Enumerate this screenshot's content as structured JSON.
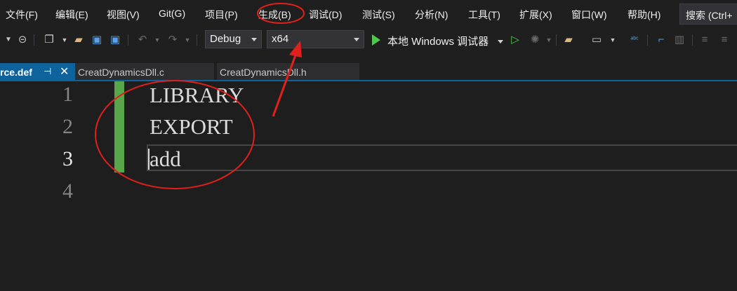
{
  "menu": {
    "items": [
      {
        "label": "文件(F)"
      },
      {
        "label": "编辑(E)"
      },
      {
        "label": "视图(V)"
      },
      {
        "label": "Git(G)"
      },
      {
        "label": "项目(P)"
      },
      {
        "label": "生成(B)"
      },
      {
        "label": "调试(D)"
      },
      {
        "label": "测试(S)"
      },
      {
        "label": "分析(N)"
      },
      {
        "label": "工具(T)"
      },
      {
        "label": "扩展(X)"
      },
      {
        "label": "窗口(W)"
      },
      {
        "label": "帮助(H)"
      }
    ],
    "search_label": "搜索 (Ctrl+"
  },
  "toolbar": {
    "configuration": "Debug",
    "platform": "x64",
    "run_label": "本地 Windows 调试器"
  },
  "tabs": {
    "active": {
      "label": "rce.def",
      "pin_icon": "pin-icon",
      "close_icon": "close-icon"
    },
    "others": [
      {
        "label": "CreatDynamicsDll.c"
      },
      {
        "label": "CreatDynamicsDll.h"
      }
    ]
  },
  "editor": {
    "line_numbers": [
      "1",
      "2",
      "3",
      "4"
    ],
    "lines": [
      "LIBRARY",
      "EXPORT",
      "add"
    ],
    "current_line": "3"
  },
  "colors": {
    "accent": "#0e639c",
    "change_bar": "#57a64a",
    "annotation": "#e0201b",
    "run": "#4ec94e"
  }
}
